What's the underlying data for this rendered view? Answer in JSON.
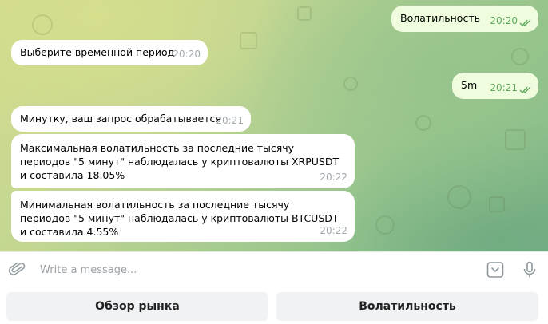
{
  "messages": {
    "m1": {
      "text": "Волатильность",
      "time": "20:20"
    },
    "m2": {
      "text": "Выберите временной период",
      "time": "20:20"
    },
    "m3": {
      "text": "5m",
      "time": "20:21"
    },
    "m4": {
      "text": "Минутку, ваш запрос обрабатывается",
      "time": "20:21"
    },
    "m5": {
      "text": "Максимальная волатильность за последние тысячу периодов \"5 минут\" наблюдалась у криптовалюты XRPUSDT и составила 18.05%",
      "time": "20:22"
    },
    "m6": {
      "text": "Минимальная волатильность за последние тысячу периодов \"5 минут\" наблюдалась у криптовалюты BTCUSDT и составила 4.55%",
      "time": "20:22"
    }
  },
  "input": {
    "placeholder": "Write a message..."
  },
  "keyboard": {
    "buttons": [
      "Обзор рынка",
      "Волатильность"
    ]
  },
  "colors": {
    "outgoing_bubble": "#effdde",
    "incoming_bubble": "#ffffff",
    "read_check": "#5da85a"
  },
  "icons": {
    "attach": "paperclip-icon",
    "keyboard": "bot-keyboard-icon",
    "voice": "microphone-icon",
    "read": "double-check-icon"
  }
}
